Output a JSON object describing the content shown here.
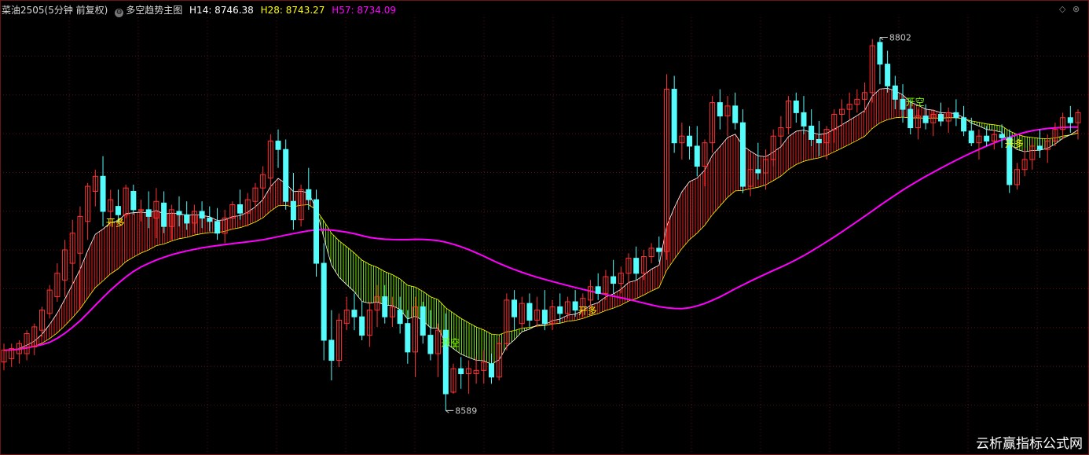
{
  "header": {
    "symbol": "菜油2505(5分钟 前复权)",
    "indicator_icon": "circle-gear-icon",
    "indicator_name": "多空趋势主图",
    "h14_label": "H14: 8746.38",
    "h28_label": "H28: 8743.27",
    "h57_label": "H57: 8734.09",
    "colors": {
      "h14": "#ffffff",
      "h28": "#ffff00",
      "h57": "#ff00ff"
    }
  },
  "controls": {
    "diamond_icon": "diamond-icon",
    "close_icon": "circle-close-icon"
  },
  "watermark": "云析赢指标公式网",
  "chart_data": {
    "type": "candlestick",
    "title": "",
    "ylim": [
      8560,
      8815
    ],
    "grid": true,
    "colors": {
      "up": "#ff3232",
      "down": "#54fcfc",
      "band_bull": "#ff2020",
      "band_bear": "#7cfc00",
      "fast_line": "#ffffff",
      "slow_line": "#ffff00",
      "trend_line": "#ff00ff"
    },
    "candles": [
      [
        8609,
        8620,
        8604,
        8616
      ],
      [
        8611,
        8620,
        8606,
        8617
      ],
      [
        8614,
        8622,
        8608,
        8620
      ],
      [
        8614,
        8628,
        8610,
        8626
      ],
      [
        8618,
        8632,
        8613,
        8630
      ],
      [
        8628,
        8642,
        8624,
        8640
      ],
      [
        8638,
        8655,
        8635,
        8652
      ],
      [
        8648,
        8668,
        8645,
        8662
      ],
      [
        8658,
        8682,
        8648,
        8676
      ],
      [
        8668,
        8694,
        8655,
        8686
      ],
      [
        8674,
        8702,
        8640,
        8696
      ],
      [
        8693,
        8716,
        8682,
        8714
      ],
      [
        8711,
        8724,
        8702,
        8720
      ],
      [
        8720,
        8732,
        8690,
        8699
      ],
      [
        8699,
        8712,
        8690,
        8706
      ],
      [
        8702,
        8712,
        8692,
        8697
      ],
      [
        8697,
        8715,
        8695,
        8713
      ],
      [
        8711,
        8715,
        8697,
        8700
      ],
      [
        8700,
        8706,
        8693,
        8700
      ],
      [
        8700,
        8711,
        8689,
        8696
      ],
      [
        8695,
        8713,
        8683,
        8705
      ],
      [
        8704,
        8711,
        8686,
        8690
      ],
      [
        8690,
        8703,
        8682,
        8700
      ],
      [
        8699,
        8708,
        8690,
        8697
      ],
      [
        8697,
        8705,
        8688,
        8692
      ],
      [
        8692,
        8703,
        8686,
        8699
      ],
      [
        8699,
        8705,
        8689,
        8695
      ],
      [
        8695,
        8702,
        8687,
        8693
      ],
      [
        8693,
        8701,
        8682,
        8686
      ],
      [
        8686,
        8700,
        8680,
        8695
      ],
      [
        8695,
        8705,
        8688,
        8703
      ],
      [
        8703,
        8712,
        8694,
        8698
      ],
      [
        8698,
        8710,
        8690,
        8706
      ],
      [
        8705,
        8716,
        8700,
        8713
      ],
      [
        8713,
        8726,
        8704,
        8721
      ],
      [
        8719,
        8745,
        8710,
        8741
      ],
      [
        8741,
        8748,
        8725,
        8736
      ],
      [
        8736,
        8742,
        8700,
        8705
      ],
      [
        8705,
        8722,
        8688,
        8694
      ],
      [
        8694,
        8715,
        8690,
        8712
      ],
      [
        8712,
        8725,
        8700,
        8706
      ],
      [
        8706,
        8712,
        8660,
        8668
      ],
      [
        8668,
        8680,
        8610,
        8622
      ],
      [
        8622,
        8640,
        8598,
        8610
      ],
      [
        8610,
        8638,
        8606,
        8634
      ],
      [
        8632,
        8648,
        8628,
        8640
      ],
      [
        8640,
        8650,
        8628,
        8636
      ],
      [
        8636,
        8645,
        8622,
        8625
      ],
      [
        8625,
        8645,
        8618,
        8640
      ],
      [
        8640,
        8655,
        8630,
        8648
      ],
      [
        8648,
        8655,
        8632,
        8636
      ],
      [
        8636,
        8648,
        8630,
        8642
      ],
      [
        8640,
        8648,
        8626,
        8632
      ],
      [
        8632,
        8640,
        8608,
        8615
      ],
      [
        8615,
        8648,
        8600,
        8642
      ],
      [
        8642,
        8645,
        8620,
        8625
      ],
      [
        8625,
        8640,
        8610,
        8614
      ],
      [
        8614,
        8632,
        8600,
        8628
      ],
      [
        8628,
        8638,
        8580,
        8590
      ],
      [
        8591,
        8608,
        8590,
        8605
      ],
      [
        8605,
        8612,
        8593,
        8602
      ],
      [
        8602,
        8610,
        8590,
        8605
      ],
      [
        8602,
        8612,
        8596,
        8604
      ],
      [
        8604,
        8616,
        8596,
        8609
      ],
      [
        8608,
        8614,
        8596,
        8600
      ],
      [
        8600,
        8624,
        8598,
        8620
      ],
      [
        8620,
        8650,
        8616,
        8646
      ],
      [
        8646,
        8652,
        8628,
        8636
      ],
      [
        8632,
        8648,
        8629,
        8644
      ],
      [
        8644,
        8650,
        8630,
        8634
      ],
      [
        8634,
        8648,
        8630,
        8640
      ],
      [
        8640,
        8652,
        8628,
        8632
      ],
      [
        8632,
        8646,
        8628,
        8642
      ],
      [
        8642,
        8650,
        8632,
        8638
      ],
      [
        8638,
        8648,
        8635,
        8645
      ],
      [
        8645,
        8652,
        8636,
        8640
      ],
      [
        8640,
        8650,
        8636,
        8647
      ],
      [
        8646,
        8658,
        8642,
        8654
      ],
      [
        8654,
        8662,
        8646,
        8650
      ],
      [
        8650,
        8664,
        8646,
        8660
      ],
      [
        8660,
        8670,
        8650,
        8656
      ],
      [
        8656,
        8666,
        8650,
        8662
      ],
      [
        8662,
        8674,
        8656,
        8671
      ],
      [
        8671,
        8678,
        8658,
        8662
      ],
      [
        8662,
        8676,
        8658,
        8672
      ],
      [
        8672,
        8680,
        8668,
        8677
      ],
      [
        8677,
        8684,
        8669,
        8675
      ],
      [
        8675,
        8781,
        8670,
        8772
      ],
      [
        8772,
        8780,
        8734,
        8740
      ],
      [
        8740,
        8752,
        8730,
        8744
      ],
      [
        8744,
        8750,
        8730,
        8738
      ],
      [
        8738,
        8750,
        8720,
        8726
      ],
      [
        8726,
        8742,
        8714,
        8740
      ],
      [
        8740,
        8768,
        8734,
        8764
      ],
      [
        8764,
        8772,
        8748,
        8756
      ],
      [
        8756,
        8768,
        8744,
        8762
      ],
      [
        8762,
        8770,
        8748,
        8752
      ],
      [
        8752,
        8760,
        8710,
        8714
      ],
      [
        8714,
        8734,
        8708,
        8724
      ],
      [
        8724,
        8740,
        8718,
        8722
      ],
      [
        8722,
        8736,
        8712,
        8730
      ],
      [
        8730,
        8748,
        8726,
        8744
      ],
      [
        8744,
        8756,
        8738,
        8749
      ],
      [
        8749,
        8768,
        8745,
        8765
      ],
      [
        8765,
        8770,
        8752,
        8758
      ],
      [
        8758,
        8768,
        8745,
        8750
      ],
      [
        8750,
        8760,
        8738,
        8742
      ],
      [
        8742,
        8753,
        8732,
        8740
      ],
      [
        8740,
        8750,
        8730,
        8748
      ],
      [
        8748,
        8760,
        8740,
        8757
      ],
      [
        8757,
        8766,
        8750,
        8760
      ],
      [
        8760,
        8770,
        8754,
        8763
      ],
      [
        8763,
        8772,
        8758,
        8766
      ],
      [
        8766,
        8776,
        8758,
        8770
      ],
      [
        8770,
        8802,
        8764,
        8798
      ],
      [
        8800,
        8803,
        8775,
        8787
      ],
      [
        8787,
        8795,
        8770,
        8774
      ],
      [
        8774,
        8780,
        8760,
        8766
      ],
      [
        8766,
        8775,
        8752,
        8760
      ],
      [
        8760,
        8766,
        8745,
        8749
      ],
      [
        8749,
        8760,
        8742,
        8756
      ],
      [
        8756,
        8763,
        8748,
        8752
      ],
      [
        8752,
        8760,
        8744,
        8757
      ],
      [
        8757,
        8764,
        8750,
        8753
      ],
      [
        8753,
        8761,
        8746,
        8758
      ],
      [
        8758,
        8766,
        8750,
        8755
      ],
      [
        8755,
        8762,
        8744,
        8747
      ],
      [
        8747,
        8755,
        8738,
        8740
      ],
      [
        8740,
        8748,
        8730,
        8744
      ],
      [
        8744,
        8750,
        8738,
        8741
      ],
      [
        8741,
        8748,
        8736,
        8745
      ],
      [
        8745,
        8751,
        8737,
        8743
      ],
      [
        8743,
        8748,
        8710,
        8715
      ],
      [
        8715,
        8728,
        8712,
        8724
      ],
      [
        8724,
        8737,
        8720,
        8730
      ],
      [
        8730,
        8742,
        8724,
        8738
      ],
      [
        8738,
        8748,
        8731,
        8736
      ],
      [
        8736,
        8745,
        8728,
        8741
      ],
      [
        8741,
        8752,
        8738,
        8748
      ],
      [
        8748,
        8758,
        8742,
        8755
      ],
      [
        8755,
        8762,
        8746,
        8752
      ],
      [
        8752,
        8760,
        8742,
        8758
      ]
    ]
  },
  "annotations": {
    "high_label": "8802",
    "low_label": "8589",
    "signals": [
      {
        "index": 14,
        "text": "开多",
        "color": "#ffff00"
      },
      {
        "index": 58,
        "text": "开空",
        "color": "#7cfc00"
      },
      {
        "index": 76,
        "text": "开多",
        "color": "#ffff00"
      },
      {
        "index": 119,
        "text": "开空",
        "color": "#7cfc00"
      },
      {
        "index": 132,
        "text": "开多",
        "color": "#ffff00"
      }
    ]
  }
}
